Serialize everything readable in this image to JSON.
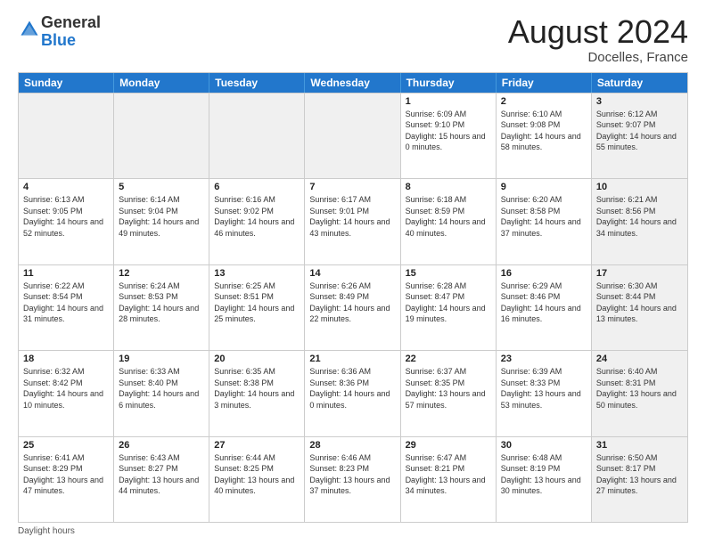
{
  "header": {
    "logo_line1": "General",
    "logo_line2": "Blue",
    "month_title": "August 2024",
    "location": "Docelles, France"
  },
  "days_of_week": [
    "Sunday",
    "Monday",
    "Tuesday",
    "Wednesday",
    "Thursday",
    "Friday",
    "Saturday"
  ],
  "weeks": [
    [
      {
        "day": "",
        "info": "",
        "shaded": true
      },
      {
        "day": "",
        "info": "",
        "shaded": true
      },
      {
        "day": "",
        "info": "",
        "shaded": true
      },
      {
        "day": "",
        "info": "",
        "shaded": true
      },
      {
        "day": "1",
        "info": "Sunrise: 6:09 AM\nSunset: 9:10 PM\nDaylight: 15 hours and 0 minutes.",
        "shaded": false
      },
      {
        "day": "2",
        "info": "Sunrise: 6:10 AM\nSunset: 9:08 PM\nDaylight: 14 hours and 58 minutes.",
        "shaded": false
      },
      {
        "day": "3",
        "info": "Sunrise: 6:12 AM\nSunset: 9:07 PM\nDaylight: 14 hours and 55 minutes.",
        "shaded": true
      }
    ],
    [
      {
        "day": "4",
        "info": "Sunrise: 6:13 AM\nSunset: 9:05 PM\nDaylight: 14 hours and 52 minutes.",
        "shaded": false
      },
      {
        "day": "5",
        "info": "Sunrise: 6:14 AM\nSunset: 9:04 PM\nDaylight: 14 hours and 49 minutes.",
        "shaded": false
      },
      {
        "day": "6",
        "info": "Sunrise: 6:16 AM\nSunset: 9:02 PM\nDaylight: 14 hours and 46 minutes.",
        "shaded": false
      },
      {
        "day": "7",
        "info": "Sunrise: 6:17 AM\nSunset: 9:01 PM\nDaylight: 14 hours and 43 minutes.",
        "shaded": false
      },
      {
        "day": "8",
        "info": "Sunrise: 6:18 AM\nSunset: 8:59 PM\nDaylight: 14 hours and 40 minutes.",
        "shaded": false
      },
      {
        "day": "9",
        "info": "Sunrise: 6:20 AM\nSunset: 8:58 PM\nDaylight: 14 hours and 37 minutes.",
        "shaded": false
      },
      {
        "day": "10",
        "info": "Sunrise: 6:21 AM\nSunset: 8:56 PM\nDaylight: 14 hours and 34 minutes.",
        "shaded": true
      }
    ],
    [
      {
        "day": "11",
        "info": "Sunrise: 6:22 AM\nSunset: 8:54 PM\nDaylight: 14 hours and 31 minutes.",
        "shaded": false
      },
      {
        "day": "12",
        "info": "Sunrise: 6:24 AM\nSunset: 8:53 PM\nDaylight: 14 hours and 28 minutes.",
        "shaded": false
      },
      {
        "day": "13",
        "info": "Sunrise: 6:25 AM\nSunset: 8:51 PM\nDaylight: 14 hours and 25 minutes.",
        "shaded": false
      },
      {
        "day": "14",
        "info": "Sunrise: 6:26 AM\nSunset: 8:49 PM\nDaylight: 14 hours and 22 minutes.",
        "shaded": false
      },
      {
        "day": "15",
        "info": "Sunrise: 6:28 AM\nSunset: 8:47 PM\nDaylight: 14 hours and 19 minutes.",
        "shaded": false
      },
      {
        "day": "16",
        "info": "Sunrise: 6:29 AM\nSunset: 8:46 PM\nDaylight: 14 hours and 16 minutes.",
        "shaded": false
      },
      {
        "day": "17",
        "info": "Sunrise: 6:30 AM\nSunset: 8:44 PM\nDaylight: 14 hours and 13 minutes.",
        "shaded": true
      }
    ],
    [
      {
        "day": "18",
        "info": "Sunrise: 6:32 AM\nSunset: 8:42 PM\nDaylight: 14 hours and 10 minutes.",
        "shaded": false
      },
      {
        "day": "19",
        "info": "Sunrise: 6:33 AM\nSunset: 8:40 PM\nDaylight: 14 hours and 6 minutes.",
        "shaded": false
      },
      {
        "day": "20",
        "info": "Sunrise: 6:35 AM\nSunset: 8:38 PM\nDaylight: 14 hours and 3 minutes.",
        "shaded": false
      },
      {
        "day": "21",
        "info": "Sunrise: 6:36 AM\nSunset: 8:36 PM\nDaylight: 14 hours and 0 minutes.",
        "shaded": false
      },
      {
        "day": "22",
        "info": "Sunrise: 6:37 AM\nSunset: 8:35 PM\nDaylight: 13 hours and 57 minutes.",
        "shaded": false
      },
      {
        "day": "23",
        "info": "Sunrise: 6:39 AM\nSunset: 8:33 PM\nDaylight: 13 hours and 53 minutes.",
        "shaded": false
      },
      {
        "day": "24",
        "info": "Sunrise: 6:40 AM\nSunset: 8:31 PM\nDaylight: 13 hours and 50 minutes.",
        "shaded": true
      }
    ],
    [
      {
        "day": "25",
        "info": "Sunrise: 6:41 AM\nSunset: 8:29 PM\nDaylight: 13 hours and 47 minutes.",
        "shaded": false
      },
      {
        "day": "26",
        "info": "Sunrise: 6:43 AM\nSunset: 8:27 PM\nDaylight: 13 hours and 44 minutes.",
        "shaded": false
      },
      {
        "day": "27",
        "info": "Sunrise: 6:44 AM\nSunset: 8:25 PM\nDaylight: 13 hours and 40 minutes.",
        "shaded": false
      },
      {
        "day": "28",
        "info": "Sunrise: 6:46 AM\nSunset: 8:23 PM\nDaylight: 13 hours and 37 minutes.",
        "shaded": false
      },
      {
        "day": "29",
        "info": "Sunrise: 6:47 AM\nSunset: 8:21 PM\nDaylight: 13 hours and 34 minutes.",
        "shaded": false
      },
      {
        "day": "30",
        "info": "Sunrise: 6:48 AM\nSunset: 8:19 PM\nDaylight: 13 hours and 30 minutes.",
        "shaded": false
      },
      {
        "day": "31",
        "info": "Sunrise: 6:50 AM\nSunset: 8:17 PM\nDaylight: 13 hours and 27 minutes.",
        "shaded": true
      }
    ]
  ],
  "footer": {
    "daylight_label": "Daylight hours"
  }
}
